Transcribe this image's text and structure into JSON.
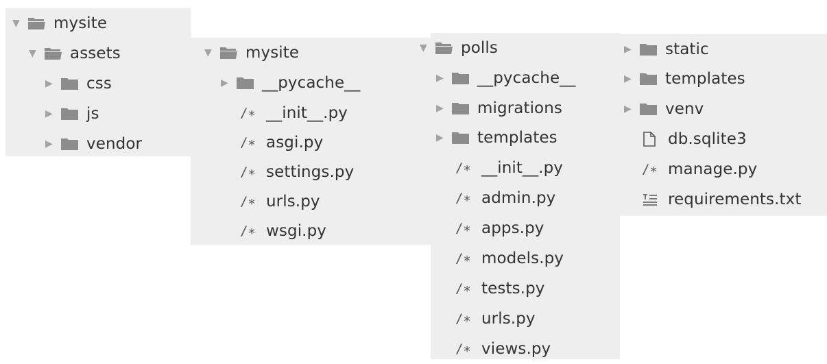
{
  "columns": [
    {
      "root": {
        "label": "mysite",
        "expanded": true
      },
      "items": [
        {
          "label": "assets",
          "kind": "folder",
          "expanded": true,
          "children": [
            {
              "label": "css",
              "kind": "folder",
              "expanded": false
            },
            {
              "label": "js",
              "kind": "folder",
              "expanded": false
            },
            {
              "label": "vendor",
              "kind": "folder",
              "expanded": false
            }
          ]
        }
      ]
    },
    {
      "root": {
        "label": "mysite",
        "expanded": true
      },
      "items": [
        {
          "label": "__pycache__",
          "kind": "folder",
          "expanded": false
        },
        {
          "label": "__init__.py",
          "kind": "python"
        },
        {
          "label": "asgi.py",
          "kind": "python"
        },
        {
          "label": "settings.py",
          "kind": "python"
        },
        {
          "label": "urls.py",
          "kind": "python"
        },
        {
          "label": "wsgi.py",
          "kind": "python"
        }
      ]
    },
    {
      "root": {
        "label": "polls",
        "expanded": true
      },
      "items": [
        {
          "label": "__pycache__",
          "kind": "folder",
          "expanded": false
        },
        {
          "label": "migrations",
          "kind": "folder",
          "expanded": false
        },
        {
          "label": "templates",
          "kind": "folder",
          "expanded": false
        },
        {
          "label": "__init__.py",
          "kind": "python"
        },
        {
          "label": "admin.py",
          "kind": "python"
        },
        {
          "label": "apps.py",
          "kind": "python"
        },
        {
          "label": "models.py",
          "kind": "python"
        },
        {
          "label": "tests.py",
          "kind": "python"
        },
        {
          "label": "urls.py",
          "kind": "python"
        },
        {
          "label": "views.py",
          "kind": "python"
        }
      ]
    },
    {
      "items": [
        {
          "label": "static",
          "kind": "folder",
          "expanded": false
        },
        {
          "label": "templates",
          "kind": "folder",
          "expanded": false
        },
        {
          "label": "venv",
          "kind": "folder",
          "expanded": false
        },
        {
          "label": "db.sqlite3",
          "kind": "file"
        },
        {
          "label": "manage.py",
          "kind": "python"
        },
        {
          "label": "requirements.txt",
          "kind": "text"
        }
      ]
    }
  ],
  "glyphs": {
    "python": "/∗",
    "expanded": "▼",
    "collapsed": "▶"
  },
  "colors": {
    "panel": "#eeeeee",
    "folder": "#8c8c8c",
    "text": "#333333",
    "arrow": "#a3a3a3"
  }
}
